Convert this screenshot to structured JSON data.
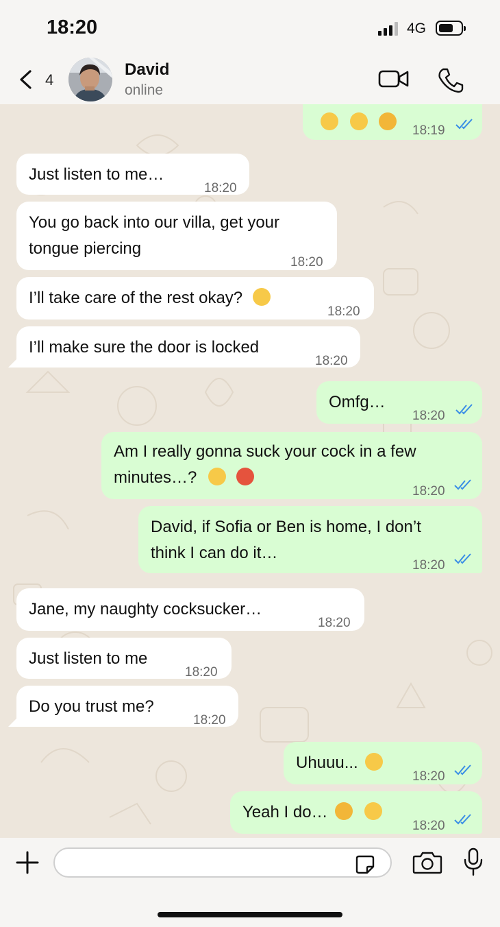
{
  "status_bar": {
    "time": "18:20",
    "network": "4G"
  },
  "header": {
    "back_count": "4",
    "contact_name": "David",
    "contact_status": "online"
  },
  "messages": [
    {
      "text": "",
      "time": "18:19",
      "direction": "out",
      "emoji": [
        "flushed-face",
        "astonished-face",
        "screaming-face"
      ]
    },
    {
      "text": "Just listen to me…",
      "time": "18:20",
      "direction": "in"
    },
    {
      "text_line1": "You go back into our villa, get your",
      "text_line2": "tongue piercing",
      "time": "18:20",
      "direction": "in"
    },
    {
      "text": "I’ll take care of the rest okay?",
      "time": "18:20",
      "direction": "in",
      "emoji": [
        "zany-face"
      ]
    },
    {
      "text": "I’ll make sure the door is locked",
      "time": "18:20",
      "direction": "in"
    },
    {
      "text": "Omfg…",
      "time": "18:20",
      "direction": "out"
    },
    {
      "text_line1": "Am I really gonna suck your cock in a few",
      "text_line2": "minutes…?",
      "time": "18:20",
      "direction": "out",
      "emoji": [
        "flushed-face",
        "hot-face"
      ]
    },
    {
      "text_line1": "David, if Sofia or Ben is home, I don’t",
      "text_line2": "think I can do it…",
      "time": "18:20",
      "direction": "out"
    },
    {
      "text": "Jane, my naughty cocksucker…",
      "time": "18:20",
      "direction": "in"
    },
    {
      "text": "Just listen to me",
      "time": "18:20",
      "direction": "in"
    },
    {
      "text": "Do you trust me?",
      "time": "18:20",
      "direction": "in"
    },
    {
      "text": "Uhuuu...",
      "time": "18:20",
      "direction": "out",
      "emoji": [
        "flushed-face"
      ]
    },
    {
      "text": "Yeah I do…",
      "time": "18:20",
      "direction": "out",
      "emoji": [
        "weary-face",
        "grimacing-face"
      ]
    }
  ],
  "composer": {
    "placeholder": ""
  },
  "colors": {
    "incoming": "#ffffff",
    "outgoing": "#d9fdd3",
    "wallpaper": "#ede6dc",
    "read_ticks": "#3a8ee6"
  }
}
